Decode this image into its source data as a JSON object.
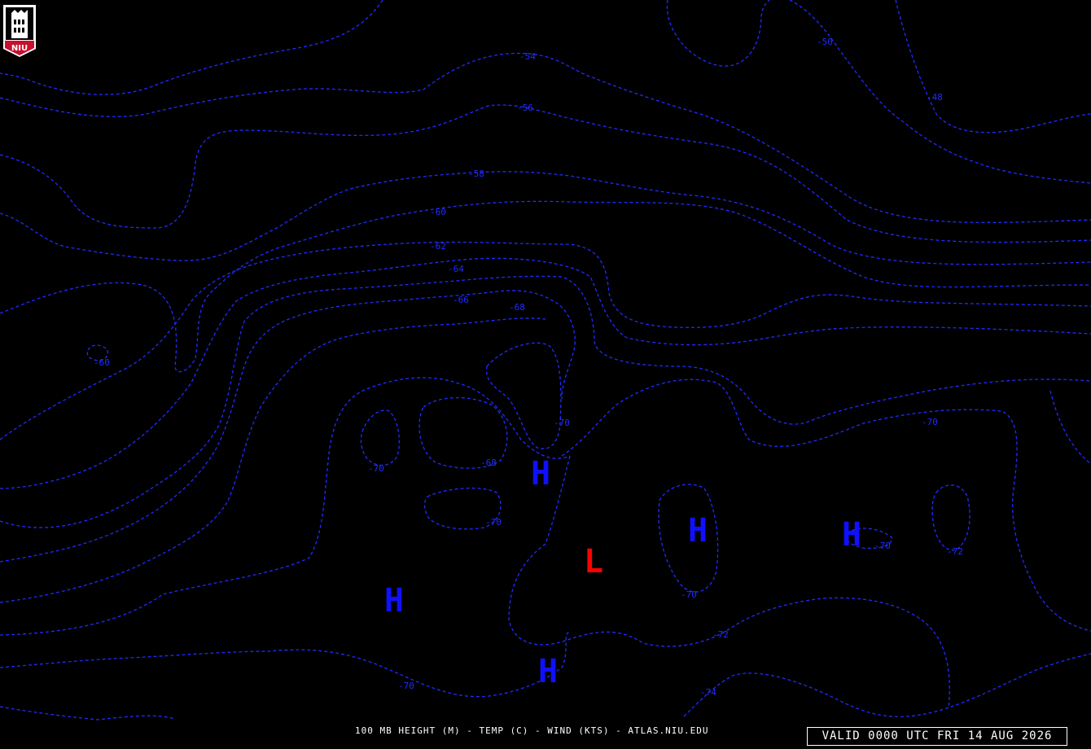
{
  "map": {
    "product_label": "100 MB HEIGHT (M) - TEMP (C) - WIND (KTS) - ATLAS.NIU.EDU",
    "valid_time": "VALID 0000 UTC FRI 14 AUG 2026",
    "logo_text": "NIU",
    "contour_color": "#1f2cff",
    "high_color": "#1010ff",
    "low_color": "#ff0000",
    "contour_labels": [
      {
        "text": "-50"
      },
      {
        "text": "-48"
      },
      {
        "text": "-54"
      },
      {
        "text": "-56"
      },
      {
        "text": "-58"
      },
      {
        "text": "-60"
      },
      {
        "text": "-62"
      },
      {
        "text": "-64"
      },
      {
        "text": "-66"
      },
      {
        "text": "-68"
      },
      {
        "text": "-60"
      },
      {
        "text": "-70"
      },
      {
        "text": "-70"
      },
      {
        "text": "-68"
      },
      {
        "text": "-70"
      },
      {
        "text": "-70"
      },
      {
        "text": "-70"
      },
      {
        "text": "-70"
      },
      {
        "text": "-72"
      },
      {
        "text": "-70"
      },
      {
        "text": "-72"
      },
      {
        "text": "-70"
      },
      {
        "text": "-74"
      }
    ],
    "pressure_centers": [
      {
        "letter": "H",
        "type": "high"
      },
      {
        "letter": "H",
        "type": "high"
      },
      {
        "letter": "H",
        "type": "high"
      },
      {
        "letter": "H",
        "type": "high"
      },
      {
        "letter": "H",
        "type": "high"
      },
      {
        "letter": "L",
        "type": "low"
      }
    ]
  }
}
